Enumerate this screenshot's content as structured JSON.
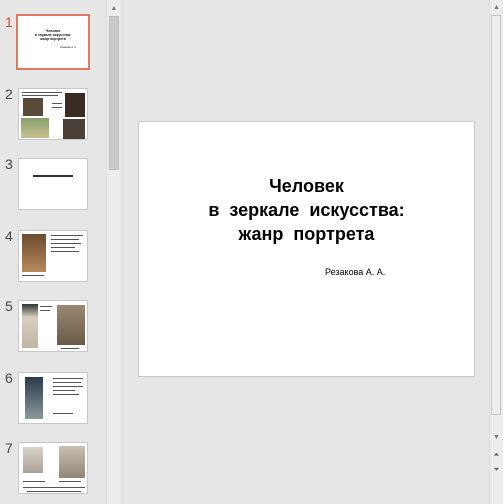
{
  "thumbnails": [
    {
      "number": "1",
      "lines": [
        "Человек",
        "в зеркале искусства:",
        "жанр портрета"
      ],
      "author": "Резакова А. А.",
      "active": true
    },
    {
      "number": "2"
    },
    {
      "number": "3"
    },
    {
      "number": "4"
    },
    {
      "number": "5"
    },
    {
      "number": "6"
    },
    {
      "number": "7"
    }
  ],
  "slide": {
    "title": "Человек\nв  зеркале  искусства:\nжанр  портрета",
    "author": "Резакова А. А."
  },
  "icons": {
    "scroll_up": "triangle-up-icon",
    "scroll_down": "triangle-down-icon",
    "prev_slide": "double-up-icon",
    "next_slide": "double-down-icon"
  },
  "colors": {
    "active_thumb_border": "#e07a5f",
    "active_number": "#d24726",
    "pane_background": "#e6e6e6"
  }
}
